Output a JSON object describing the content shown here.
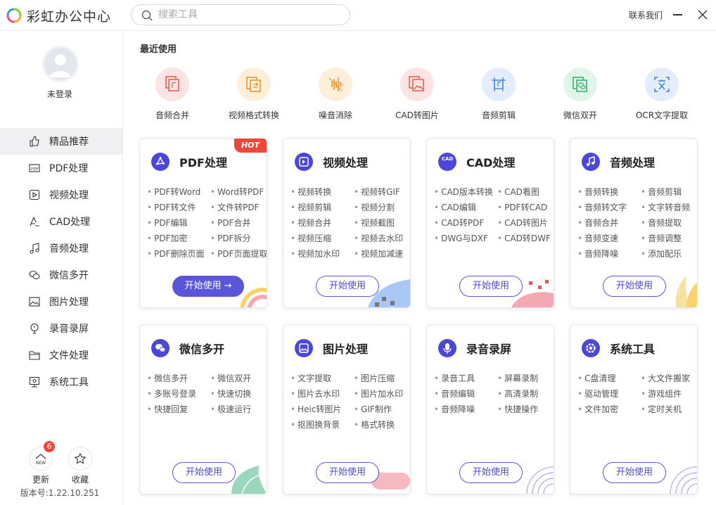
{
  "app": {
    "title": "彩虹办公中心"
  },
  "search": {
    "placeholder": "搜索工具"
  },
  "header": {
    "contact": "联系我们"
  },
  "user": {
    "status": "未登录"
  },
  "sidebar": {
    "items": [
      {
        "label": "精品推荐",
        "icon": "thumbs-up-icon",
        "active": true
      },
      {
        "label": "PDF处理",
        "icon": "pdf-icon"
      },
      {
        "label": "视频处理",
        "icon": "video-icon"
      },
      {
        "label": "CAD处理",
        "icon": "cad-icon"
      },
      {
        "label": "音频处理",
        "icon": "music-note-icon"
      },
      {
        "label": "微信多开",
        "icon": "wechat-icon"
      },
      {
        "label": "图片处理",
        "icon": "image-icon"
      },
      {
        "label": "录音录屏",
        "icon": "record-icon"
      },
      {
        "label": "文件处理",
        "icon": "folder-icon"
      },
      {
        "label": "系统工具",
        "icon": "monitor-icon"
      }
    ],
    "update_label": "更新",
    "update_badge": "6",
    "update_icon_text": "NEW",
    "favorite_label": "收藏",
    "version": "版本号:1.22.10.251"
  },
  "recent": {
    "title": "最近使用",
    "items": [
      {
        "label": "音频合并",
        "color": "#fde3e1"
      },
      {
        "label": "视频格式转换",
        "color": "#fdefd9"
      },
      {
        "label": "噪音消除",
        "color": "#fdefd9"
      },
      {
        "label": "CAD转图片",
        "color": "#fde3e1"
      },
      {
        "label": "音频剪辑",
        "color": "#e3edfb"
      },
      {
        "label": "微信双开",
        "color": "#e1f5ea"
      },
      {
        "label": "OCR文字提取",
        "color": "#e3edfb"
      }
    ]
  },
  "cards": [
    {
      "title": "PDF处理",
      "hot": "HOT",
      "features": [
        "PDF转Word",
        "Word转PDF",
        "PDF转文件",
        "文件转PDF",
        "PDF编辑",
        "PDF合并",
        "PDF加密",
        "PDF拆分",
        "PDF删除页面",
        "PDF页面提取"
      ],
      "button": "开始使用 →",
      "primary": true
    },
    {
      "title": "视频处理",
      "features": [
        "视频转换",
        "视频转GIF",
        "视频剪辑",
        "视频分割",
        "视频合并",
        "视频截图",
        "视频压缩",
        "视频去水印",
        "视频加水印",
        "视频加减速"
      ],
      "button": "开始使用"
    },
    {
      "title": "CAD处理",
      "icon_text": "CAD",
      "features": [
        "CAD版本转换",
        "CAD看图",
        "CAD编辑",
        "PDF转CAD",
        "CAD转PDF",
        "CAD转图片",
        "DWG与DXF",
        "CAD转DWF"
      ],
      "button": "开始使用"
    },
    {
      "title": "音频处理",
      "features": [
        "音频转换",
        "音频剪辑",
        "音频转文字",
        "文字转音频",
        "音频合并",
        "音频提取",
        "音频变速",
        "音频调整",
        "音频降噪",
        "添加配乐"
      ],
      "button": "开始使用"
    },
    {
      "title": "微信多开",
      "features": [
        "微信多开",
        "微信双开",
        "多账号登录",
        "快速切换",
        "快捷回复",
        "极速运行"
      ],
      "button": "开始使用"
    },
    {
      "title": "图片处理",
      "features": [
        "文字提取",
        "图片压缩",
        "图片去水印",
        "图片加水印",
        "Heic转图片",
        "GIF制作",
        "抠图换背景",
        "格式转换"
      ],
      "button": "开始使用"
    },
    {
      "title": "录音录屏",
      "features": [
        "录音工具",
        "屏幕录制",
        "音频编辑",
        "高清录制",
        "音频降噪",
        "快捷操作"
      ],
      "button": "开始使用"
    },
    {
      "title": "系统工具",
      "features": [
        "C盘清理",
        "大文件搬家",
        "驱动管理",
        "游戏组件",
        "文件加密",
        "定时关机"
      ],
      "button": "开始使用"
    }
  ]
}
